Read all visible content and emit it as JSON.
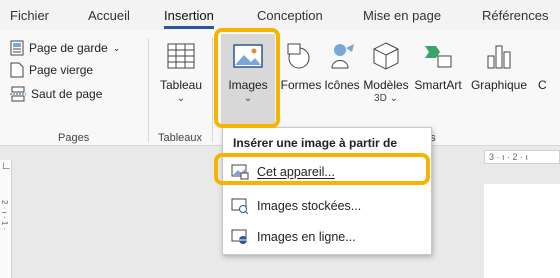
{
  "tabs": [
    "Fichier",
    "Accueil",
    "Insertion",
    "Conception",
    "Mise en page",
    "Références"
  ],
  "active_tab": "Insertion",
  "pages_group": {
    "label": "Pages",
    "items": [
      "Page de garde",
      "Page vierge",
      "Saut de page"
    ]
  },
  "tableaux_group": {
    "label": "Tableaux",
    "button": "Tableau"
  },
  "illustrations": {
    "images": "Images",
    "formes": "Formes",
    "icones": "Icônes",
    "modeles_line1": "Modèles",
    "modeles_line2": "3D",
    "smartart": "SmartArt",
    "graphique": "Graphique",
    "group_partial": "ns"
  },
  "dropdown": {
    "title": "Insérer une image à partir de",
    "items": [
      "Cet appareil...",
      "Images stockées...",
      "Images en ligne..."
    ]
  },
  "ruler": {
    "top": "3 · ı · 2 · ı",
    "left": "2 · ı · 1 ·"
  },
  "colors": {
    "highlight": "#f5b400",
    "accent": "#2b579a"
  }
}
